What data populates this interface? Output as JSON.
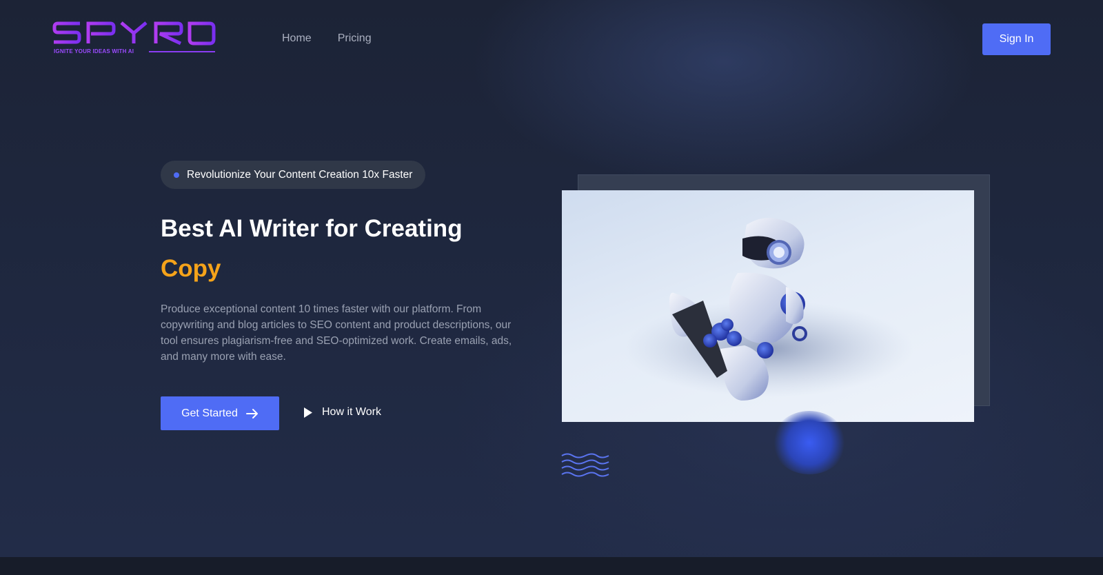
{
  "brand": {
    "name": "SPYRO",
    "tagline": "IGNITE YOUR IDEAS WITH AI",
    "color": "#8b3df5"
  },
  "nav": {
    "items": [
      "Home",
      "Pricing"
    ]
  },
  "header": {
    "signin_label": "Sign In"
  },
  "hero": {
    "badge": "Revolutionize Your Content Creation 10x Faster",
    "title": "Best AI Writer for Creating",
    "title_accent": "Copy",
    "description": "Produce exceptional content 10 times faster with our platform. From copywriting and blog articles to SEO content and product descriptions, our tool ensures plagiarism-free and SEO-optimized work. Create emails, ads, and many more with ease.",
    "cta_primary": "Get Started",
    "cta_secondary": "How it Work"
  },
  "icons": {
    "cta_primary": "arrow-right-icon",
    "cta_secondary": "play-icon",
    "decoration": "wave-lines-icon"
  },
  "colors": {
    "accent": "#4f6cf5",
    "highlight": "#f5a31a",
    "background": "#1c2336"
  }
}
